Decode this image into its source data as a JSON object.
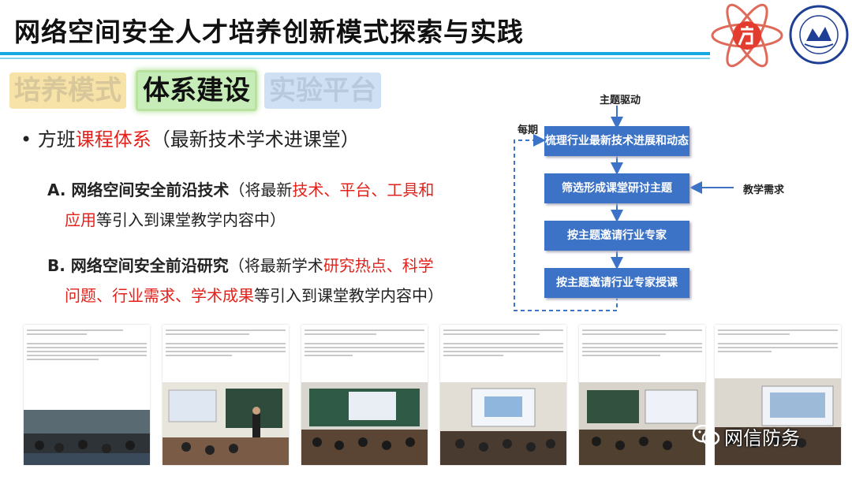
{
  "header": {
    "title": "网络空间安全人才培养创新模式探索与实践"
  },
  "tabs": [
    {
      "label": "培养模式"
    },
    {
      "label": "体系建设"
    },
    {
      "label": "实验平台"
    }
  ],
  "bullet": {
    "symbol": "•",
    "prefix": "方班",
    "highlight": "课程体系",
    "suffix": "（最新技术学术进课堂）"
  },
  "point_a": {
    "heading": "A. 网络空间安全前沿技术",
    "text1": "（将最新",
    "hl1": "技术、平台、工具和",
    "hl2": "应用",
    "text2": "等引入到课堂教学内容中）"
  },
  "point_b": {
    "heading": "B. 网络空间安全前沿研究",
    "text1": "（将最新学术",
    "hl1": "研究热点、科学",
    "hl2": "问题、行业需求、学术成果",
    "text2": "等引入到课堂教学内容中）"
  },
  "flow": {
    "top_label": "主题驱动",
    "loop_label": "每期",
    "side_label": "教学需求",
    "steps": [
      "梳理行业最新技术进展和动态",
      "筛选形成课堂研讨主题",
      "按主题邀请行业专家",
      "按主题邀请行业专家授课"
    ]
  },
  "watermark": {
    "text": "网信防务"
  },
  "colors": {
    "accent": "#17a7e0",
    "flow_box": "#3d73c7",
    "highlight": "#e3221b"
  }
}
